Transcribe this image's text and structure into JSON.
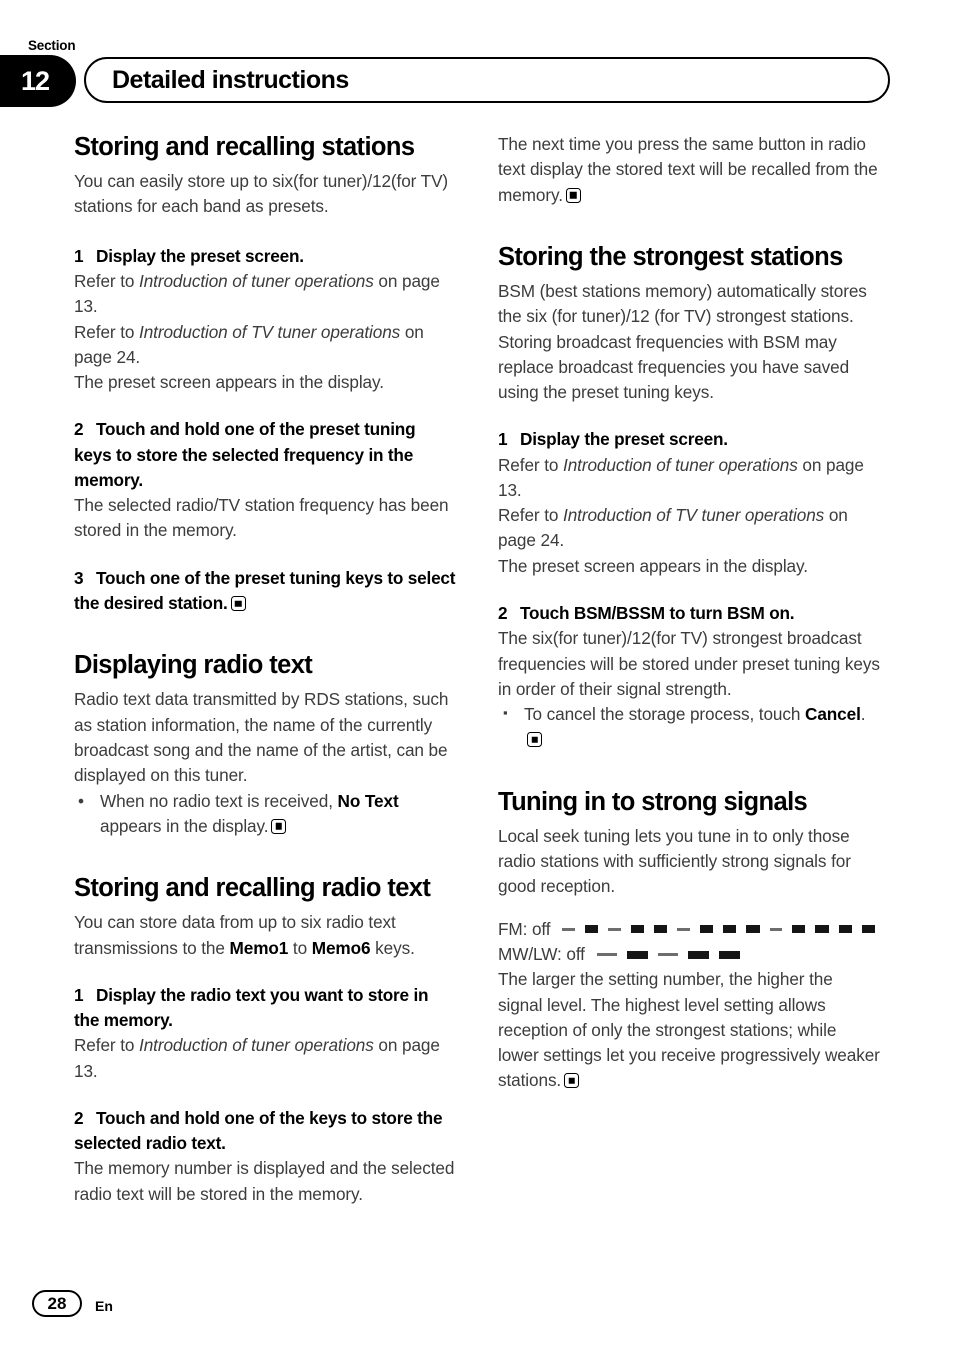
{
  "header": {
    "section_label": "Section",
    "section_number": "12",
    "title": "Detailed instructions"
  },
  "left_column": {
    "topic1": {
      "heading": "Storing and recalling stations",
      "intro": "You can easily store up to six(for tuner)/12(for TV) stations for each band as presets.",
      "step1_num": "1",
      "step1_text": "Display the preset screen.",
      "step1_refer_a_pre": "Refer to ",
      "step1_refer_a_italic": "Introduction of tuner operations",
      "step1_refer_a_post": " on page 13.",
      "step1_refer_b_pre": "Refer to ",
      "step1_refer_b_italic": "Introduction of TV tuner operations",
      "step1_refer_b_post": " on page 24.",
      "step1_result": "The preset screen appears in the display.",
      "step2_num": "2",
      "step2_text": "Touch and hold one of the preset tuning keys to store the selected frequency in the memory.",
      "step2_result": "The selected radio/TV station frequency has been stored in the memory.",
      "step3_num": "3",
      "step3_text": "Touch one of the preset tuning keys to select the desired station."
    },
    "topic2": {
      "heading": "Displaying radio text",
      "intro": "Radio text data transmitted by RDS stations, such as station information, the name of the currently broadcast song and the name of the artist, can be displayed on this tuner.",
      "bullet_marker": "•",
      "bullet_pre": "When no radio text is received, ",
      "bullet_bold": "No Text",
      "bullet_post": " appears in the display."
    },
    "topic3": {
      "heading": "Storing and recalling radio text",
      "intro_pre": "You can store data from up to six radio text transmissions to the ",
      "intro_bold1": "Memo1",
      "intro_mid": " to ",
      "intro_bold2": "Memo6",
      "intro_post": " keys.",
      "step1_num": "1",
      "step1_text": "Display the radio text you want to store in the memory.",
      "step1_refer_pre": "Refer to ",
      "step1_refer_italic": "Introduction of tuner operations",
      "step1_refer_post": " on page 13.",
      "step2_num": "2",
      "step2_text": "Touch and hold one of the keys to store the selected radio text.",
      "step2_result": "The memory number is displayed and the selected radio text will be stored in the memory."
    }
  },
  "right_column": {
    "topic3_cont": {
      "text": "The next time you press the same button in radio text display the stored text will be recalled from the memory."
    },
    "topic4": {
      "heading": "Storing the strongest stations",
      "intro1": "BSM (best stations memory) automatically stores the six (for tuner)/12 (for TV) strongest stations.",
      "intro2": "Storing broadcast frequencies with BSM may replace broadcast frequencies you have saved using the preset tuning keys.",
      "step1_num": "1",
      "step1_text": "Display the preset screen.",
      "step1_refer_a_pre": "Refer to ",
      "step1_refer_a_italic": "Introduction of tuner operations",
      "step1_refer_a_post": " on page 13.",
      "step1_refer_b_pre": "Refer to ",
      "step1_refer_b_italic": "Introduction of TV tuner operations",
      "step1_refer_b_post": " on page 24.",
      "step1_result": "The preset screen appears in the display.",
      "step2_num": "2",
      "step2_text": "Touch BSM/BSSM to turn BSM on.",
      "step2_result": "The six(for tuner)/12(for TV) strongest broadcast frequencies will be stored under preset tuning keys in order of their signal strength.",
      "bullet_marker": "▪",
      "bullet_pre": "To cancel the storage process, touch ",
      "bullet_bold": "Cancel",
      "bullet_post": "."
    },
    "topic5": {
      "heading": "Tuning in to strong signals",
      "intro": "Local seek tuning lets you tune in to only those radio stations with sufficiently strong signals for good reception.",
      "scales": [
        {
          "label": "FM: off",
          "pattern": [
            "dash",
            "bar",
            "dash",
            "bar",
            "bar",
            "dash",
            "bar",
            "bar",
            "bar",
            "dash",
            "bar",
            "bar",
            "bar",
            "bar"
          ]
        },
        {
          "label": "MW/LW: off",
          "pattern": [
            "dash",
            "bar",
            "dash",
            "bar",
            "bar"
          ]
        }
      ],
      "outro": "The larger the setting number, the higher the signal level. The highest level setting allows reception of only the strongest stations; while lower settings let you receive progressively weaker stations."
    }
  },
  "footer": {
    "page_number": "28",
    "language": "En"
  }
}
